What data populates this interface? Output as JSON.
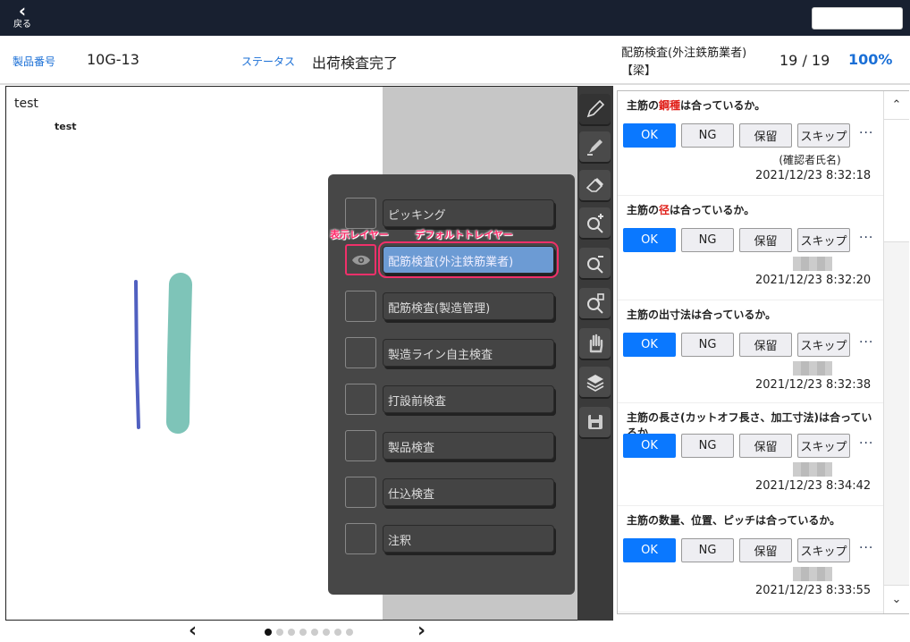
{
  "topbar": {
    "back_label": "戻る"
  },
  "info": {
    "product_label": "製品番号",
    "product_value": "10G-13",
    "status_label": "ステータス",
    "status_value": "出荷検査完了",
    "inspection_name": "配筋検査(外注鉄筋業者)",
    "inspection_sub": "【梁】",
    "progress_text": "19 / 19",
    "progress_percent": "100%"
  },
  "canvas": {
    "text_large": "test",
    "text_small": "test"
  },
  "tools": [
    "pencil-icon",
    "highlighter-icon",
    "eraser-icon",
    "zoom-in-icon",
    "zoom-out-icon",
    "zoom-fit-icon",
    "hand-icon",
    "layers-icon",
    "save-icon"
  ],
  "layers": {
    "annotation_visible": "表示レイヤー",
    "annotation_default": "デフォルトトレイヤー",
    "items": [
      {
        "label": "ピッキング"
      },
      {
        "label": "配筋検査(外注鉄筋業者)",
        "visible": true,
        "default": true
      },
      {
        "label": "配筋検査(製造管理)"
      },
      {
        "label": "製造ライン自主検査"
      },
      {
        "label": "打設前検査"
      },
      {
        "label": "製品検査"
      },
      {
        "label": "仕込検査"
      },
      {
        "label": "注釈"
      }
    ]
  },
  "buttons": {
    "ok": "OK",
    "ng": "NG",
    "hold": "保留",
    "skip": "スキップ",
    "more": "···"
  },
  "checklist": [
    {
      "pre": "主筋の",
      "hl": "鋼種",
      "post": "は合っているか。",
      "who": "(確認者氏名)",
      "time": "2021/12/23 8:32:18",
      "selected": "OK"
    },
    {
      "pre": "主筋の",
      "hl": "径",
      "post": "は合っているか。",
      "time": "2021/12/23 8:32:20",
      "selected": "OK"
    },
    {
      "pre": "主筋の出寸法は合っているか。",
      "time": "2021/12/23 8:32:38",
      "selected": "OK"
    },
    {
      "pre": "主筋の長さ(カットオフ長さ、加工寸法)は合っているか。",
      "time": "2021/12/23 8:34:42",
      "selected": "OK"
    },
    {
      "pre": "主筋の数量、位置、ピッチは合っているか。",
      "time": "2021/12/23 8:33:55",
      "selected": "OK"
    }
  ],
  "pager": {
    "pages": 8,
    "current": 1
  },
  "colors": {
    "accent": "#0a78ff",
    "highlight": "#e0201a",
    "annotation": "#ff2a6a",
    "stroke_blue": "#5060c0",
    "stroke_teal": "#7ec4b8"
  }
}
